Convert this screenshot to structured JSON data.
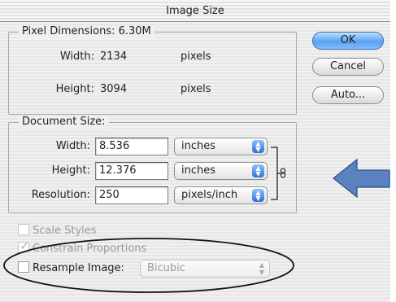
{
  "window": {
    "title": "Image Size"
  },
  "pixel_dimensions": {
    "legend": "Pixel Dimensions:",
    "size": "6.30M",
    "width_label": "Width:",
    "width_value": "2134",
    "width_unit": "pixels",
    "height_label": "Height:",
    "height_value": "3094",
    "height_unit": "pixels"
  },
  "document_size": {
    "legend": "Document Size:",
    "width_label": "Width:",
    "width_value": "8.536",
    "width_unit": "inches",
    "height_label": "Height:",
    "height_value": "12.376",
    "height_unit": "inches",
    "resolution_label": "Resolution:",
    "resolution_value": "250",
    "resolution_unit": "pixels/inch"
  },
  "buttons": {
    "ok": "OK",
    "cancel": "Cancel",
    "auto": "Auto..."
  },
  "options": {
    "scale_styles": "Scale Styles",
    "constrain": "Constrain Proportions",
    "resample": "Resample Image:",
    "resample_method": "Bicubic"
  },
  "colors": {
    "arrow": "#5a82bf",
    "default_button": "#5aa2f0"
  },
  "icons": {
    "link": "chain-link-icon",
    "stepper": "updown-arrows-icon"
  }
}
